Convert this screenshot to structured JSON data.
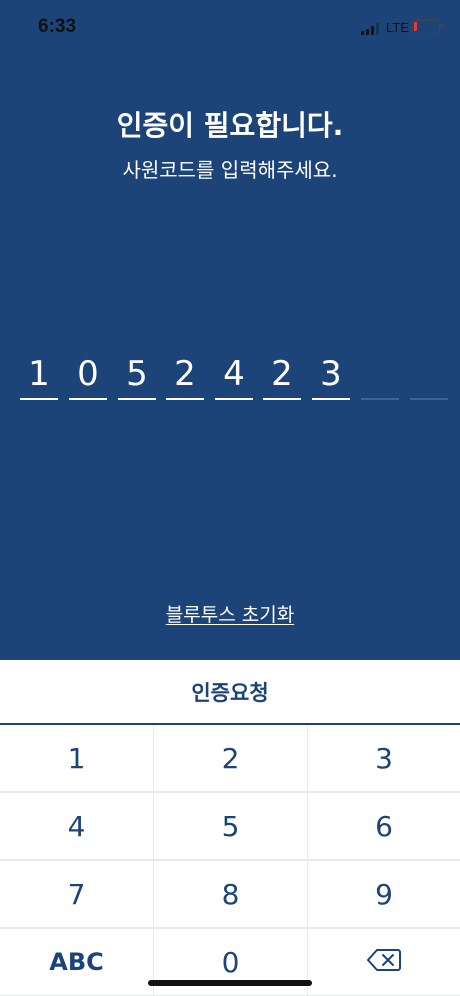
{
  "status_bar": {
    "time": "6:33",
    "network": "LTE"
  },
  "header": {
    "title": "인증이 필요합니다.",
    "subtitle": "사원코드를 입력해주세요."
  },
  "code": {
    "digits": [
      "1",
      "0",
      "5",
      "2",
      "4",
      "2",
      "3",
      "",
      ""
    ]
  },
  "reset_link": "블루투스 초기화",
  "request_button": "인증요청",
  "keypad": {
    "keys": [
      "1",
      "2",
      "3",
      "4",
      "5",
      "6",
      "7",
      "8",
      "9",
      "ABC",
      "0",
      "delete"
    ]
  },
  "colors": {
    "primary": "#1d4478",
    "white": "#ffffff",
    "divider": "#e6eaef",
    "battery_low": "#e53935"
  }
}
